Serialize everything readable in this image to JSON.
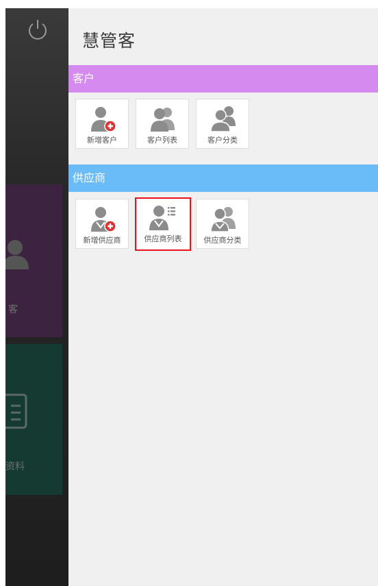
{
  "app": {
    "title": "慧管客"
  },
  "side_panel": {
    "tiles": [
      {
        "label": "客",
        "icon": "person-icon",
        "color": "#3c2440"
      },
      {
        "label": "资料",
        "icon": "book-icon",
        "color": "#143a32"
      }
    ]
  },
  "sections": [
    {
      "title": "客户",
      "color": "#d58aef",
      "items": [
        {
          "label": "新增客户",
          "icon": "add-customer-icon"
        },
        {
          "label": "客户列表",
          "icon": "customer-list-icon"
        },
        {
          "label": "客户分类",
          "icon": "customer-category-icon"
        }
      ]
    },
    {
      "title": "供应商",
      "color": "#69bcf7",
      "items": [
        {
          "label": "新增供应商",
          "icon": "add-supplier-icon"
        },
        {
          "label": "供应商列表",
          "icon": "supplier-list-icon",
          "selected": true
        },
        {
          "label": "供应商分类",
          "icon": "supplier-category-icon"
        }
      ]
    }
  ],
  "colors": {
    "highlight": "#e8121b",
    "add_badge": "#e03030",
    "icon_gray": "#8c8c8c"
  }
}
